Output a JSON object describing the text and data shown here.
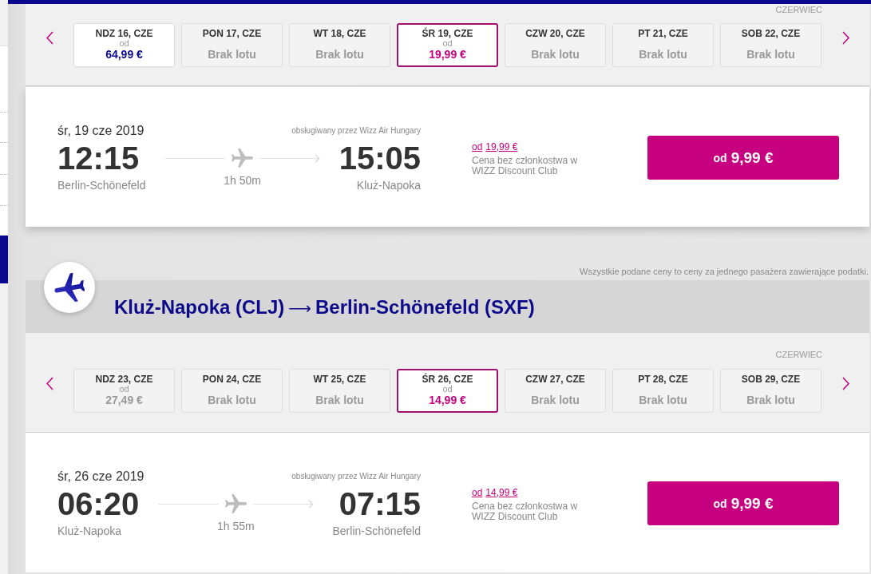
{
  "outbound": {
    "month": "CZERWIEC",
    "days": [
      {
        "label": "NDZ 16, CZE",
        "from": "od",
        "price": "64,99 €",
        "selected": false,
        "disabled": false
      },
      {
        "label": "PON 17, CZE",
        "note": "Brak lotu",
        "selected": false,
        "disabled": true
      },
      {
        "label": "WT 18, CZE",
        "note": "Brak lotu",
        "selected": false,
        "disabled": true
      },
      {
        "label": "ŚR 19, CZE",
        "from": "od",
        "price": "19,99 €",
        "selected": true,
        "disabled": false
      },
      {
        "label": "CZW 20, CZE",
        "note": "Brak lotu",
        "selected": false,
        "disabled": true
      },
      {
        "label": "PT 21, CZE",
        "note": "Brak lotu",
        "selected": false,
        "disabled": true
      },
      {
        "label": "SOB 22, CZE",
        "note": "Brak lotu",
        "selected": false,
        "disabled": true
      }
    ],
    "flight": {
      "date": "śr, 19 cze 2019",
      "operator": "obsługiwany przez Wizz Air Hungary",
      "departure": {
        "time": "12:15",
        "city": "Berlin-Schönefeld"
      },
      "duration": "1h 50m",
      "arrival": {
        "time": "15:05",
        "city": "Kluż-Napoka"
      },
      "standard_price": {
        "prefix": "od",
        "price": "19,99 €"
      },
      "price_note": "Cena bez członkostwa w WIZZ Discount Club",
      "button": {
        "prefix": "od",
        "price": "9,99 €"
      }
    }
  },
  "price_notice": "Wszystkie podane ceny to ceny za jednego pasażera zawierające podatki.",
  "return": {
    "route": {
      "origin": "Kluż-Napoka (CLJ)",
      "arrow": "⟶",
      "destination": "Berlin-Schönefeld (SXF)"
    },
    "month": "CZERWIEC",
    "days": [
      {
        "label": "NDZ 23, CZE",
        "from": "od",
        "price": "27,49 €",
        "selected": false,
        "disabled": true
      },
      {
        "label": "PON 24, CZE",
        "note": "Brak lotu",
        "selected": false,
        "disabled": true
      },
      {
        "label": "WT 25, CZE",
        "note": "Brak lotu",
        "selected": false,
        "disabled": true
      },
      {
        "label": "ŚR 26, CZE",
        "from": "od",
        "price": "14,99 €",
        "selected": true,
        "disabled": false
      },
      {
        "label": "CZW 27, CZE",
        "note": "Brak lotu",
        "selected": false,
        "disabled": true
      },
      {
        "label": "PT 28, CZE",
        "note": "Brak lotu",
        "selected": false,
        "disabled": true
      },
      {
        "label": "SOB 29, CZE",
        "note": "Brak lotu",
        "selected": false,
        "disabled": true
      }
    ],
    "flight": {
      "date": "śr, 26 cze 2019",
      "operator": "obsługiwany przez Wizz Air Hungary",
      "departure": {
        "time": "06:20",
        "city": "Kluż-Napoka"
      },
      "duration": "1h 55m",
      "arrival": {
        "time": "07:15",
        "city": "Berlin-Schönefeld"
      },
      "standard_price": {
        "prefix": "od",
        "price": "14,99 €"
      },
      "price_note": "Cena bez członkostwa w WIZZ Discount Club",
      "button": {
        "prefix": "od",
        "price": "9,99 €"
      }
    }
  }
}
